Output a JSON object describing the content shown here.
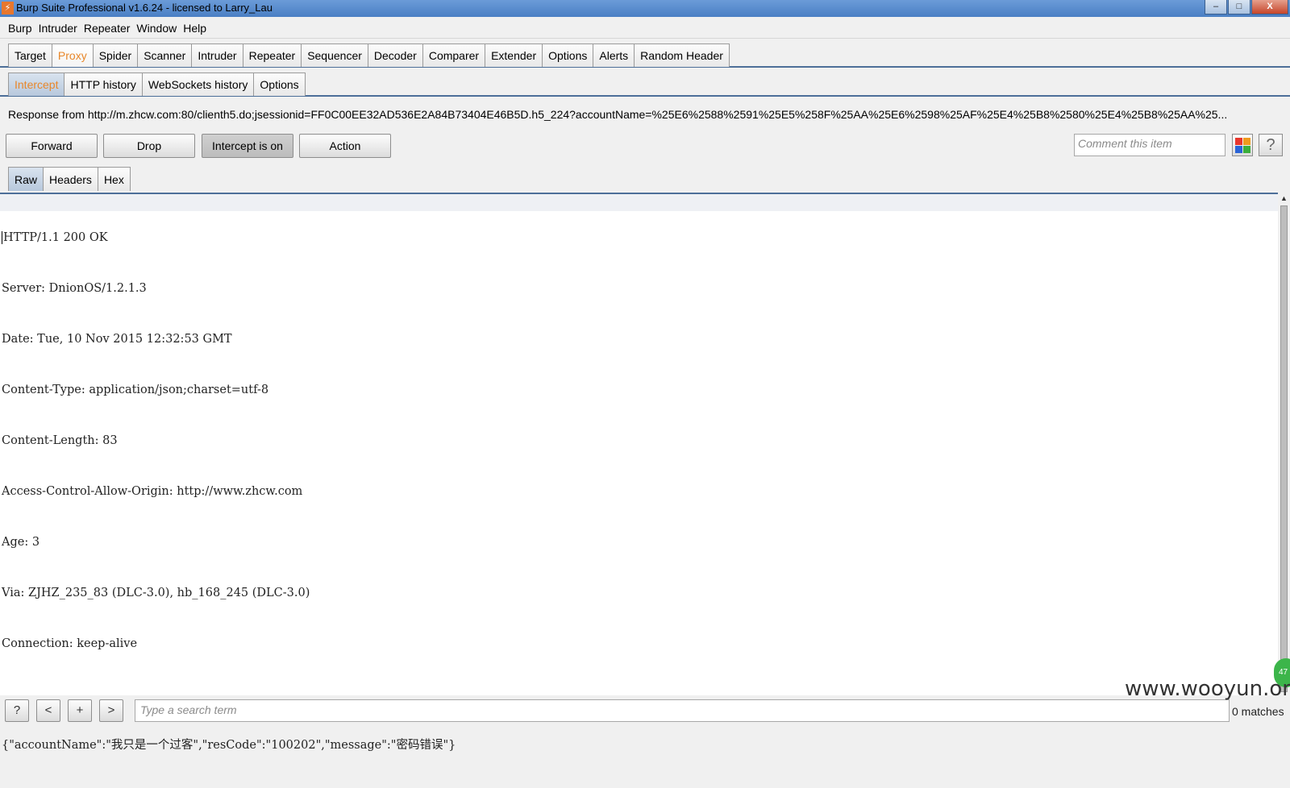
{
  "window": {
    "title": "Burp Suite Professional v1.6.24 - licensed to Larry_Lau",
    "controls": {
      "minimize": "–",
      "maximize": "□",
      "close": "X"
    }
  },
  "menu": [
    "Burp",
    "Intruder",
    "Repeater",
    "Window",
    "Help"
  ],
  "main_tabs": [
    "Target",
    "Proxy",
    "Spider",
    "Scanner",
    "Intruder",
    "Repeater",
    "Sequencer",
    "Decoder",
    "Comparer",
    "Extender",
    "Options",
    "Alerts",
    "Random Header"
  ],
  "proxy_tabs": [
    "Intercept",
    "HTTP history",
    "WebSockets history",
    "Options"
  ],
  "intercept": {
    "response_line": "Response from http://m.zhcw.com:80/clienth5.do;jsessionid=FF0C00EE32AD536E2A84B73404E46B5D.h5_224?accountName=%25E6%2588%2591%25E5%258F%25AA%25E6%2598%25AF%25E4%25B8%2580%25E4%25B8%25AA%25...",
    "buttons": {
      "forward": "Forward",
      "drop": "Drop",
      "intercept": "Intercept is on",
      "action": "Action"
    },
    "comment_placeholder": "Comment this item",
    "help": "?"
  },
  "view_tabs": [
    "Raw",
    "Headers",
    "Hex"
  ],
  "response_lines": [
    "HTTP/1.1 200 OK",
    "Server: DnionOS/1.2.1.3",
    "Date: Tue, 10 Nov 2015 12:32:53 GMT",
    "Content-Type: application/json;charset=utf-8",
    "Content-Length: 83",
    "Access-Control-Allow-Origin: http://www.zhcw.com",
    "Age: 3",
    "Via: ZJHZ_235_83 (DLC-3.0), hb_168_245 (DLC-3.0)",
    "Connection: keep-alive",
    "",
    "{\"accountName\":\"我只是一个过客\",\"resCode\":\"100202\",\"message\":\"密码错误\"}"
  ],
  "search": {
    "help": "?",
    "prev": "<",
    "add": "+",
    "next": ">",
    "placeholder": "Type a search term",
    "matches": "0 matches"
  },
  "badge": "47",
  "watermark": "www.wooyun.org",
  "colors": {
    "active_tab_text": "#e8872a",
    "title_bar": "#4a7fc4",
    "tab_border": "#4d6f99"
  }
}
